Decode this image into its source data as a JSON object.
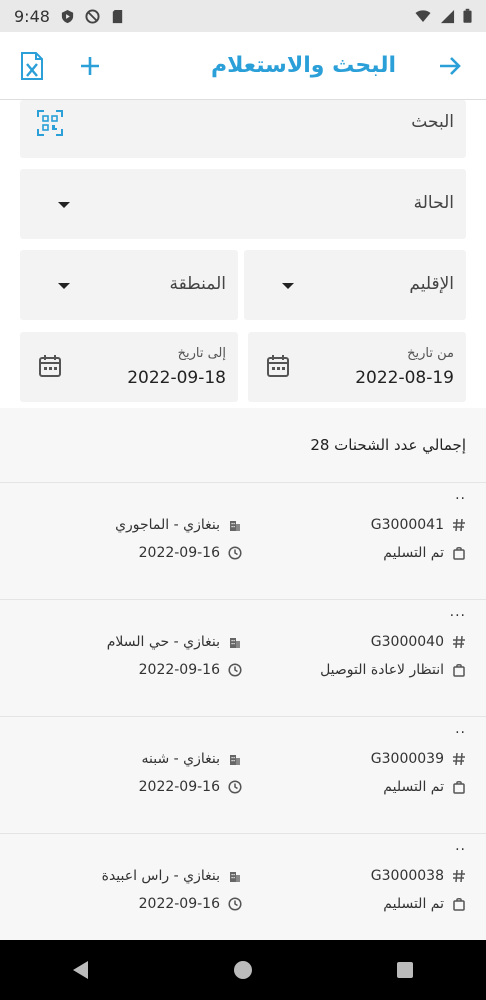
{
  "status_bar": {
    "time": "9:48"
  },
  "app_bar": {
    "title": "البحث والاستعلام"
  },
  "filters": {
    "search_placeholder": "البحث",
    "status_label": "الحالة",
    "region_label": "الإقليم",
    "area_label": "المنطقة",
    "from_date_label": "من تاريخ",
    "from_date_value": "2022-08-19",
    "to_date_label": "إلى تاريخ",
    "to_date_value": "2022-09-18"
  },
  "summary": {
    "total_text": "إجمالي عدد الشحنات 28"
  },
  "shipments": [
    {
      "dots": "..",
      "code": "G3000041",
      "location": "بنغازي - الماجوري",
      "status": "تم التسليم",
      "date": "2022-09-16"
    },
    {
      "dots": "...",
      "code": "G3000040",
      "location": "بنغازي - حي السلام",
      "status": "انتظار لاعادة التوصيل",
      "date": "2022-09-16"
    },
    {
      "dots": "..",
      "code": "G3000039",
      "location": "بنغازي - شبنه",
      "status": "تم التسليم",
      "date": "2022-09-16"
    },
    {
      "dots": "..",
      "code": "G3000038",
      "location": "بنغازي - راس اعبيدة",
      "status": "تم التسليم",
      "date": "2022-09-16"
    }
  ],
  "colors": {
    "accent": "#2a9fd8",
    "field_bg": "#f3f3f3",
    "list_bg": "#f7f7f7"
  },
  "icons": {
    "back": "arrow-right-icon",
    "add": "plus-icon",
    "excel": "excel-export-icon",
    "scan": "qr-scan-icon",
    "calendar": "calendar-icon",
    "hash": "hash-icon",
    "building": "building-icon",
    "bag": "bag-icon",
    "clock": "clock-icon"
  }
}
